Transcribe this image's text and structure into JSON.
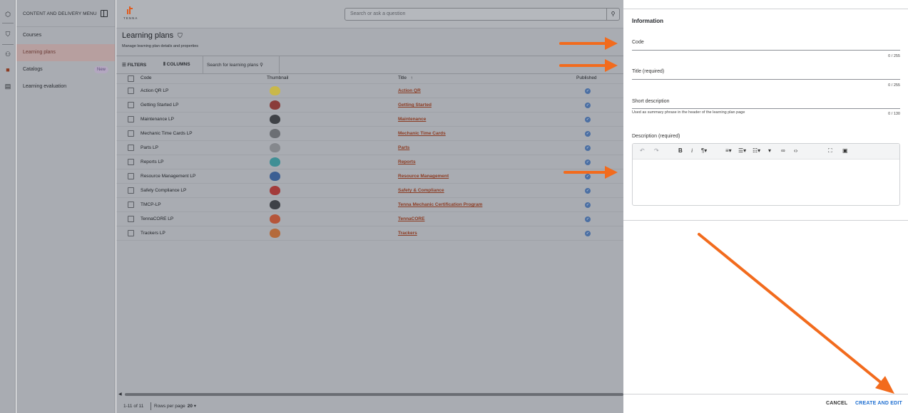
{
  "menu": {
    "title": "CONTENT AND DELIVERY MENU",
    "items": [
      {
        "label": "Courses"
      },
      {
        "label": "Learning plans"
      },
      {
        "label": "Catalogs",
        "badge": "New"
      },
      {
        "label": "Learning evaluation"
      }
    ]
  },
  "brand": {
    "logo_text": "TENNA",
    "accent": "#e05a1c"
  },
  "search": {
    "placeholder": "Search or ask a question"
  },
  "page": {
    "title": "Learning plans",
    "subtitle": "Manage learning plan details and properties"
  },
  "toolbar": {
    "filters_label": "FILTERS",
    "columns_label": "COLUMNS",
    "search_placeholder": "Search for learning plans"
  },
  "table": {
    "columns": {
      "code": "Code",
      "thumbnail": "Thumbnail",
      "title": "Title",
      "sort_indicator": "↑",
      "published": "Published"
    },
    "rows": [
      {
        "code": "Action QR LP",
        "title": "Action QR",
        "thumb_color": "#c9b84a"
      },
      {
        "code": "Getting Started LP",
        "title": "Getting Started",
        "thumb_color": "#8a3c3a"
      },
      {
        "code": "Maintenance LP",
        "title": "Maintenance",
        "thumb_color": "#3f4247"
      },
      {
        "code": "Mechanic Time Cards LP",
        "title": "Mechanic Time Cards",
        "thumb_color": "#6c6f74"
      },
      {
        "code": "Parts LP",
        "title": "Parts",
        "thumb_color": "#85888d"
      },
      {
        "code": "Reports LP",
        "title": "Reports",
        "thumb_color": "#3f8f95"
      },
      {
        "code": "Resource Management LP",
        "title": "Resource Management",
        "thumb_color": "#3c5f93"
      },
      {
        "code": "Safety Compliance LP",
        "title": "Safety & Compliance",
        "thumb_color": "#a33b3b"
      },
      {
        "code": "TMCP-LP",
        "title": "Tenna Mechanic Certification Program",
        "thumb_color": "#3e4147"
      },
      {
        "code": "TennaCORE LP",
        "title": "TennaCORE",
        "thumb_color": "#b5553a"
      },
      {
        "code": "Trackers LP",
        "title": "Trackers",
        "thumb_color": "#b46a3b"
      }
    ]
  },
  "pagination": {
    "range": "1-11 of 11",
    "rows_per_page_label": "Rows per page",
    "rows_per_page": "20"
  },
  "panel": {
    "section_title": "Information",
    "fields": {
      "code_label": "Code",
      "code_count": "0 / 255",
      "title_label": "Title (required)",
      "title_count": "0 / 255",
      "short_label": "Short description",
      "short_help": "Used as summary phrase in the header of the learning plan page",
      "short_count": "0 / 130",
      "desc_label": "Description (required)"
    },
    "cancel_label": "CANCEL",
    "create_label": "CREATE AND EDIT",
    "link_color": "#1f6fd1"
  },
  "annotations": {
    "arrow_color": "#f26b1d"
  }
}
